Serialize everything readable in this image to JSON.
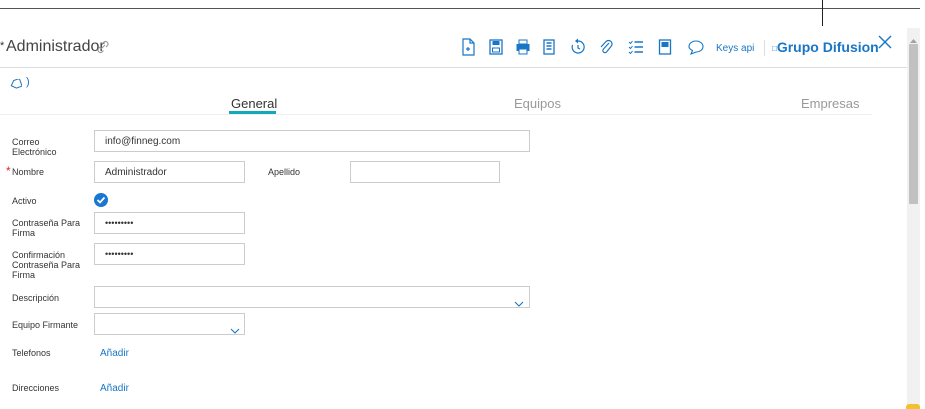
{
  "header": {
    "title": "Administrador",
    "keys_api": "Keys api",
    "group": "Grupo Difusion",
    "group_prefix": "□"
  },
  "toolbar_icons": [
    "new-document-icon",
    "save-icon",
    "print-icon",
    "copy-icon",
    "history-icon",
    "attach-icon",
    "checklist-icon",
    "note-icon",
    "comment-icon"
  ],
  "tag_chevron": ")",
  "tabs": [
    {
      "label": "General",
      "active": true
    },
    {
      "label": "Equipos",
      "active": false
    },
    {
      "label": "Empresas",
      "active": false
    }
  ],
  "form": {
    "correo_label": "Correo Electrónico",
    "correo_value": "info@finneg.com",
    "nombre_label": "Nombre",
    "nombre_value": "Administrador",
    "apellido_label": "Apellido",
    "apellido_value": "",
    "activo_label": "Activo",
    "activo_checked": true,
    "contrasena_label": "Contraseña Para Firma",
    "contrasena_value": "•••••••••",
    "confirmacion_label": "Confirmación Contraseña Para Firma",
    "confirmacion_value": "•••••••••",
    "descripcion_label": "Descripción",
    "descripcion_value": "",
    "equipo_label": "Equipo Firmante",
    "equipo_value": "",
    "telefonos_label": "Telefonos",
    "telefonos_add": "Añadir",
    "direcciones_label": "Direcciones",
    "direcciones_add": "Añadir"
  },
  "colors": {
    "accent": "#1976c6",
    "tab_underline": "#13a9b8",
    "required": "#d32f2f"
  }
}
